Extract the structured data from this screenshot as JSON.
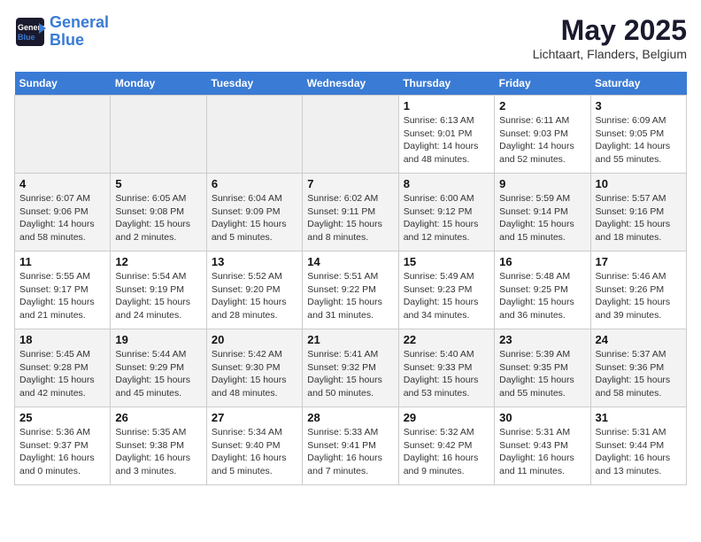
{
  "header": {
    "logo_line1": "General",
    "logo_line2": "Blue",
    "title": "May 2025",
    "subtitle": "Lichtaart, Flanders, Belgium"
  },
  "days_of_week": [
    "Sunday",
    "Monday",
    "Tuesday",
    "Wednesday",
    "Thursday",
    "Friday",
    "Saturday"
  ],
  "weeks": [
    [
      {
        "num": "",
        "info": ""
      },
      {
        "num": "",
        "info": ""
      },
      {
        "num": "",
        "info": ""
      },
      {
        "num": "",
        "info": ""
      },
      {
        "num": "1",
        "info": "Sunrise: 6:13 AM\nSunset: 9:01 PM\nDaylight: 14 hours and 48 minutes."
      },
      {
        "num": "2",
        "info": "Sunrise: 6:11 AM\nSunset: 9:03 PM\nDaylight: 14 hours and 52 minutes."
      },
      {
        "num": "3",
        "info": "Sunrise: 6:09 AM\nSunset: 9:05 PM\nDaylight: 14 hours and 55 minutes."
      }
    ],
    [
      {
        "num": "4",
        "info": "Sunrise: 6:07 AM\nSunset: 9:06 PM\nDaylight: 14 hours and 58 minutes."
      },
      {
        "num": "5",
        "info": "Sunrise: 6:05 AM\nSunset: 9:08 PM\nDaylight: 15 hours and 2 minutes."
      },
      {
        "num": "6",
        "info": "Sunrise: 6:04 AM\nSunset: 9:09 PM\nDaylight: 15 hours and 5 minutes."
      },
      {
        "num": "7",
        "info": "Sunrise: 6:02 AM\nSunset: 9:11 PM\nDaylight: 15 hours and 8 minutes."
      },
      {
        "num": "8",
        "info": "Sunrise: 6:00 AM\nSunset: 9:12 PM\nDaylight: 15 hours and 12 minutes."
      },
      {
        "num": "9",
        "info": "Sunrise: 5:59 AM\nSunset: 9:14 PM\nDaylight: 15 hours and 15 minutes."
      },
      {
        "num": "10",
        "info": "Sunrise: 5:57 AM\nSunset: 9:16 PM\nDaylight: 15 hours and 18 minutes."
      }
    ],
    [
      {
        "num": "11",
        "info": "Sunrise: 5:55 AM\nSunset: 9:17 PM\nDaylight: 15 hours and 21 minutes."
      },
      {
        "num": "12",
        "info": "Sunrise: 5:54 AM\nSunset: 9:19 PM\nDaylight: 15 hours and 24 minutes."
      },
      {
        "num": "13",
        "info": "Sunrise: 5:52 AM\nSunset: 9:20 PM\nDaylight: 15 hours and 28 minutes."
      },
      {
        "num": "14",
        "info": "Sunrise: 5:51 AM\nSunset: 9:22 PM\nDaylight: 15 hours and 31 minutes."
      },
      {
        "num": "15",
        "info": "Sunrise: 5:49 AM\nSunset: 9:23 PM\nDaylight: 15 hours and 34 minutes."
      },
      {
        "num": "16",
        "info": "Sunrise: 5:48 AM\nSunset: 9:25 PM\nDaylight: 15 hours and 36 minutes."
      },
      {
        "num": "17",
        "info": "Sunrise: 5:46 AM\nSunset: 9:26 PM\nDaylight: 15 hours and 39 minutes."
      }
    ],
    [
      {
        "num": "18",
        "info": "Sunrise: 5:45 AM\nSunset: 9:28 PM\nDaylight: 15 hours and 42 minutes."
      },
      {
        "num": "19",
        "info": "Sunrise: 5:44 AM\nSunset: 9:29 PM\nDaylight: 15 hours and 45 minutes."
      },
      {
        "num": "20",
        "info": "Sunrise: 5:42 AM\nSunset: 9:30 PM\nDaylight: 15 hours and 48 minutes."
      },
      {
        "num": "21",
        "info": "Sunrise: 5:41 AM\nSunset: 9:32 PM\nDaylight: 15 hours and 50 minutes."
      },
      {
        "num": "22",
        "info": "Sunrise: 5:40 AM\nSunset: 9:33 PM\nDaylight: 15 hours and 53 minutes."
      },
      {
        "num": "23",
        "info": "Sunrise: 5:39 AM\nSunset: 9:35 PM\nDaylight: 15 hours and 55 minutes."
      },
      {
        "num": "24",
        "info": "Sunrise: 5:37 AM\nSunset: 9:36 PM\nDaylight: 15 hours and 58 minutes."
      }
    ],
    [
      {
        "num": "25",
        "info": "Sunrise: 5:36 AM\nSunset: 9:37 PM\nDaylight: 16 hours and 0 minutes."
      },
      {
        "num": "26",
        "info": "Sunrise: 5:35 AM\nSunset: 9:38 PM\nDaylight: 16 hours and 3 minutes."
      },
      {
        "num": "27",
        "info": "Sunrise: 5:34 AM\nSunset: 9:40 PM\nDaylight: 16 hours and 5 minutes."
      },
      {
        "num": "28",
        "info": "Sunrise: 5:33 AM\nSunset: 9:41 PM\nDaylight: 16 hours and 7 minutes."
      },
      {
        "num": "29",
        "info": "Sunrise: 5:32 AM\nSunset: 9:42 PM\nDaylight: 16 hours and 9 minutes."
      },
      {
        "num": "30",
        "info": "Sunrise: 5:31 AM\nSunset: 9:43 PM\nDaylight: 16 hours and 11 minutes."
      },
      {
        "num": "31",
        "info": "Sunrise: 5:31 AM\nSunset: 9:44 PM\nDaylight: 16 hours and 13 minutes."
      }
    ]
  ]
}
